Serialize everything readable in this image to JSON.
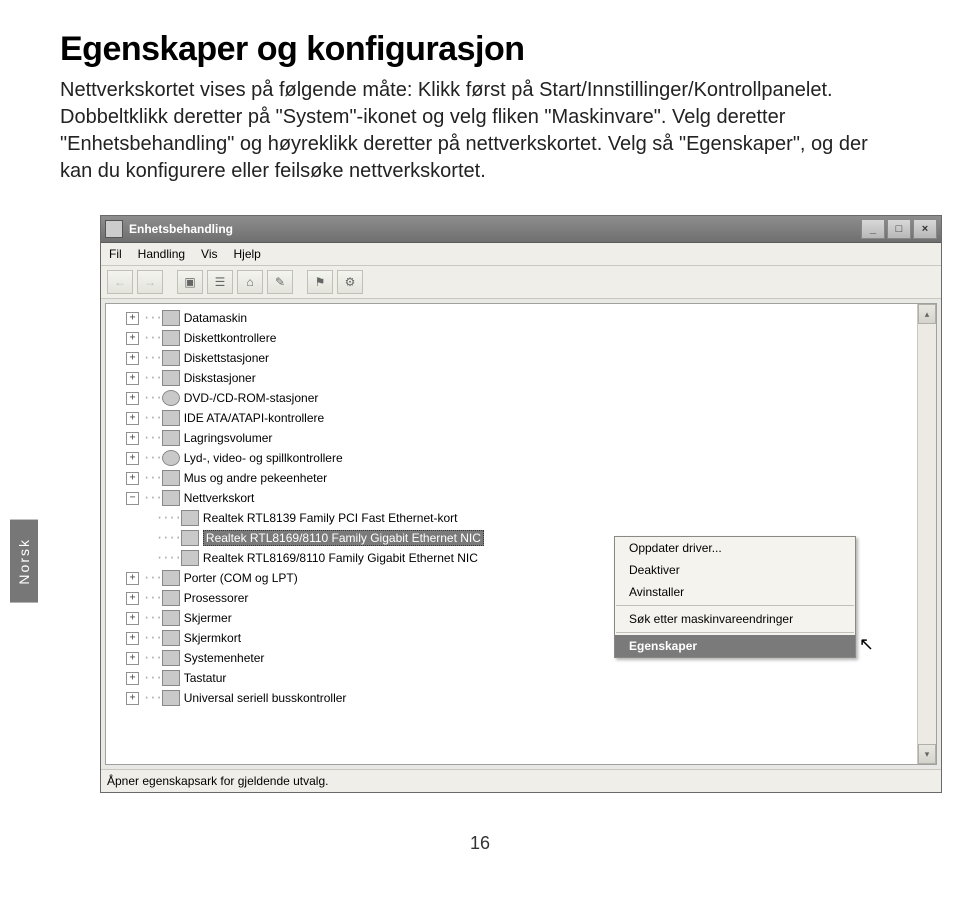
{
  "heading": "Egenskaper og konfigurasjon",
  "body": "Nettverkskortet vises på følgende måte: Klikk først på Start/Innstillinger/Kontrollpanelet. Dobbeltklikk deretter på \"System\"-ikonet og velg fliken \"Maskinvare\". Velg deretter \"Enhetsbehandling\" og høyreklikk deretter på nettverkskortet. Velg så \"Egenskaper\", og der kan du konfigurere eller feilsøke nettverkskortet.",
  "side_tab": "Norsk",
  "page_number": "16",
  "window": {
    "title": "Enhetsbehandling",
    "minimize": "_",
    "maximize": "□",
    "close": "×",
    "menu": {
      "fil": "Fil",
      "handling": "Handling",
      "vis": "Vis",
      "hjelp": "Hjelp"
    },
    "status": "Åpner egenskapsark for gjeldende utvalg.",
    "tree": [
      {
        "label": "Datamaskin",
        "exp": "+"
      },
      {
        "label": "Diskettkontrollere",
        "exp": "+"
      },
      {
        "label": "Diskettstasjoner",
        "exp": "+"
      },
      {
        "label": "Diskstasjoner",
        "exp": "+"
      },
      {
        "label": "DVD-/CD-ROM-stasjoner",
        "exp": "+"
      },
      {
        "label": "IDE ATA/ATAPI-kontrollere",
        "exp": "+"
      },
      {
        "label": "Lagringsvolumer",
        "exp": "+"
      },
      {
        "label": "Lyd-, video- og spillkontrollere",
        "exp": "+"
      },
      {
        "label": "Mus og andre pekeenheter",
        "exp": "+"
      },
      {
        "label": "Nettverkskort",
        "exp": "−"
      },
      {
        "label": "Realtek RTL8139 Family PCI Fast Ethernet-kort",
        "child": true
      },
      {
        "label": "Realtek RTL8169/8110 Family Gigabit Ethernet NIC",
        "child": true,
        "selected": true
      },
      {
        "label": "Realtek RTL8169/8110 Family Gigabit Ethernet NIC",
        "child": true
      },
      {
        "label": "Porter (COM og LPT)",
        "exp": "+"
      },
      {
        "label": "Prosessorer",
        "exp": "+"
      },
      {
        "label": "Skjermer",
        "exp": "+"
      },
      {
        "label": "Skjermkort",
        "exp": "+"
      },
      {
        "label": "Systemenheter",
        "exp": "+"
      },
      {
        "label": "Tastatur",
        "exp": "+"
      },
      {
        "label": "Universal seriell busskontroller",
        "exp": "+"
      }
    ],
    "context_menu": {
      "update": "Oppdater driver...",
      "disable": "Deaktiver",
      "uninstall": "Avinstaller",
      "scan": "Søk etter maskinvareendringer",
      "props": "Egenskaper"
    }
  }
}
